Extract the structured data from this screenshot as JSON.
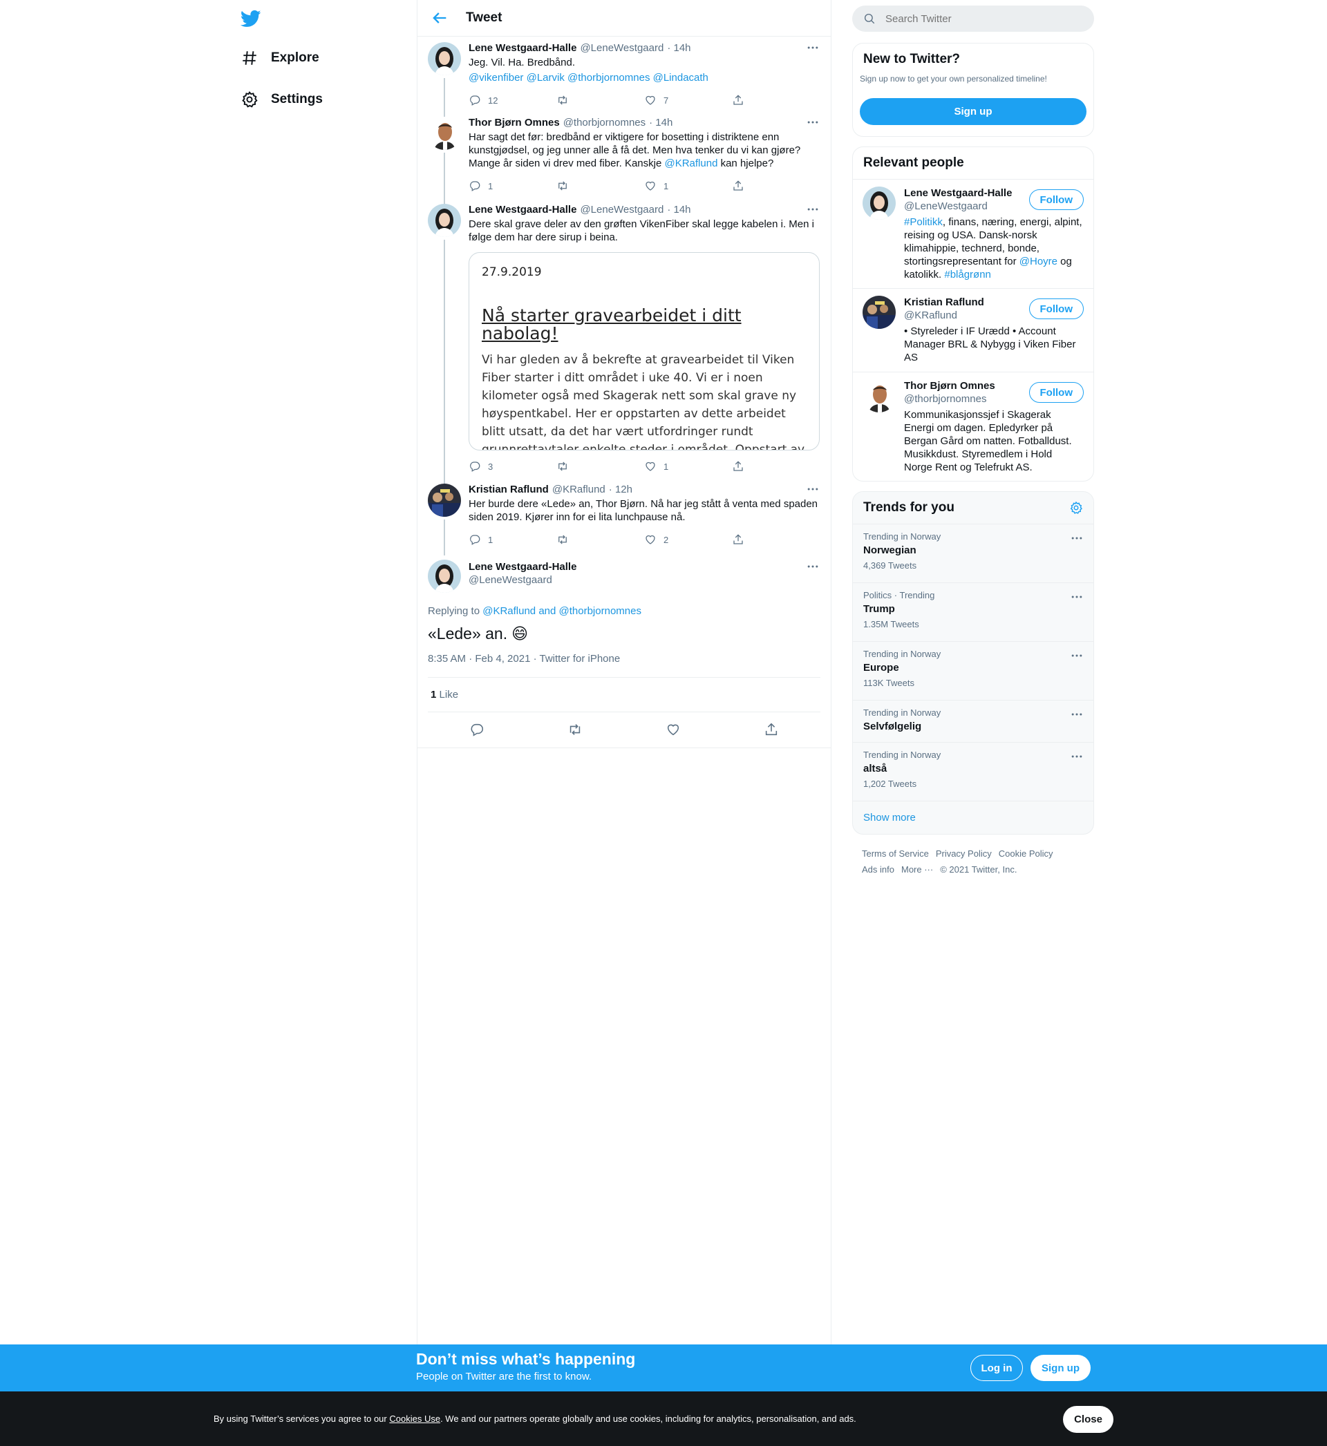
{
  "nav": {
    "explore": "Explore",
    "settings": "Settings"
  },
  "header": {
    "title": "Tweet"
  },
  "tweets": [
    {
      "name": "Lene Westgaard-Halle",
      "handle": "@LeneWestgaard",
      "time": "· 14h",
      "text": "Jeg. Vil. Ha. Bredbånd.",
      "mentions": "@vikenfiber @Larvik @thorbjornomnes  @Lindacath",
      "replies": "12",
      "retweets": "",
      "likes": "7"
    },
    {
      "name": "Thor Bjørn Omnes",
      "handle": "@thorbjornomnes",
      "time": "· 14h",
      "text_a": "Har sagt det før: bredbånd er viktigere for bosetting i distriktene enn kunstgjødsel, og jeg unner alle å få det. Men hva tenker du vi kan gjøre? Mange år siden vi drev med fiber. Kanskje ",
      "mention": "@KRaflund",
      "text_b": " kan hjelpe?",
      "replies": "1",
      "retweets": "",
      "likes": "1"
    },
    {
      "name": "Lene Westgaard-Halle",
      "handle": "@LeneWestgaard",
      "time": "· 14h",
      "text": "Dere skal grave deler av den grøften VikenFiber skal legge kabelen i. Men i følge dem har dere sirup i beina.",
      "card": {
        "date": "27.9.2019",
        "title": "Nå starter gravearbeidet i ditt nabolag!",
        "body": "Vi har gleden av å bekrefte at gravearbeidet til Viken Fiber starter i ditt området i uke 40. Vi er i noen kilometer også med Skagerak nett som skal grave ny høyspentkabel. Her er oppstarten av dette arbeidet blitt utsatt, da det har vært utfordringer rundt grunnrettavtaler enkelte steder i området. Oppstart av"
      },
      "replies": "3",
      "retweets": "",
      "likes": "1"
    },
    {
      "name": "Kristian Raflund",
      "handle": "@KRaflund",
      "time": "· 12h",
      "text": "Her burde dere «Lede» an, Thor  Bjørn. Nå har jeg stått å venta med spaden siden 2019. Kjører inn for ei lita lunchpause nå.",
      "replies": "1",
      "retweets": "",
      "likes": "2"
    }
  ],
  "focus": {
    "name": "Lene Westgaard-Halle",
    "handle": "@LeneWestgaard",
    "replying_prefix": "Replying to ",
    "replying_to": "@KRaflund and @thorbjornomnes",
    "text": "«Lede» an.",
    "emoji": "😄",
    "meta": "8:35 AM · Feb 4, 2021 · Twitter for iPhone",
    "like_count": "1",
    "like_label": "Like"
  },
  "search": {
    "placeholder": "Search Twitter"
  },
  "new_to_twitter": {
    "title": "New to Twitter?",
    "subtitle": "Sign up now to get your own personalized timeline!",
    "button": "Sign up"
  },
  "relevant": {
    "title": "Relevant people",
    "follow_label": "Follow",
    "people": [
      {
        "name": "Lene Westgaard-Halle",
        "handle": "@LeneWestgaard",
        "bio_tag": "#Politikk",
        "bio_a": ", finans, næring, energi, alpint, reising og USA. Dansk-norsk klimahippie, technerd, bonde, stortingsrepresentant for ",
        "bio_mention": "@Hoyre",
        "bio_b": " og katolikk. ",
        "bio_tag2": "#blågrønn"
      },
      {
        "name": "Kristian Raflund",
        "handle": "@KRaflund",
        "bio": "• Styreleder i IF Urædd • Account Manager BRL & Nybygg i Viken Fiber AS"
      },
      {
        "name": "Thor Bjørn Omnes",
        "handle": "@thorbjornomnes",
        "bio": "Kommunikasjonssjef i Skagerak Energi om dagen. Epledyrker på Bergan Gård om natten. Fotballdust. Musikkdust. Styremedlem i Hold Norge Rent og Telefrukt AS."
      }
    ]
  },
  "trends": {
    "title": "Trends for you",
    "items": [
      {
        "context": "Trending in Norway",
        "name": "Norwegian",
        "count": "4,369 Tweets"
      },
      {
        "context": "Politics · Trending",
        "name": "Trump",
        "count": "1.35M Tweets"
      },
      {
        "context": "Trending in Norway",
        "name": "Europe",
        "count": "113K Tweets"
      },
      {
        "context": "Trending in Norway",
        "name": "Selvfølgelig",
        "count": ""
      },
      {
        "context": "Trending in Norway",
        "name": "altså",
        "count": "1,202 Tweets"
      }
    ],
    "show_more": "Show more"
  },
  "footer": {
    "terms": "Terms of Service",
    "privacy": "Privacy Policy",
    "cookie": "Cookie Policy",
    "ads": "Ads info",
    "more": "More ···",
    "copyright": "© 2021 Twitter, Inc."
  },
  "banner": {
    "title": "Don’t miss what’s happening",
    "subtitle": "People on Twitter are the first to know.",
    "login": "Log in",
    "signup": "Sign up"
  },
  "cookie_bar": {
    "text_a": "By using Twitter’s services you agree to our ",
    "link": "Cookies Use",
    "text_b": ". We and our partners operate globally and use cookies, including for analytics, personalisation, and ads.",
    "close": "Close"
  },
  "colors": {
    "accent": "#1da1f2",
    "link": "#1b95e0",
    "muted": "#5b7083",
    "banner": "#1da1f2",
    "cookie_bg": "#14171a"
  }
}
